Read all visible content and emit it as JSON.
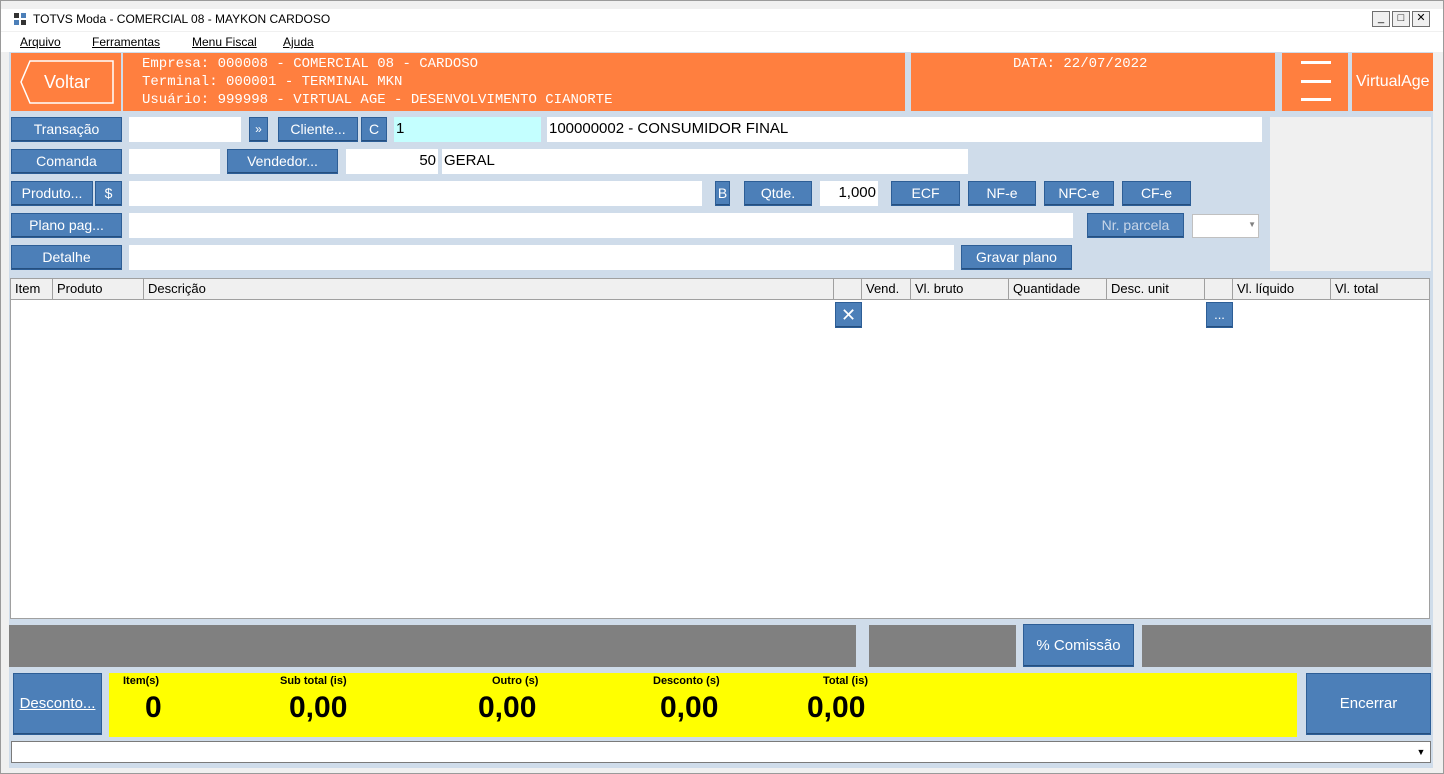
{
  "window": {
    "title": "TOTVS Moda - COMERCIAL 08 - MAYKON CARDOSO",
    "minimize": "_",
    "maximize": "□",
    "close": "✕"
  },
  "menubar": [
    "Arquivo",
    "Ferramentas",
    "Menu Fiscal",
    "Ajuda"
  ],
  "header": {
    "back_label": "Voltar",
    "empresa": "Empresa: 000008 - COMERCIAL 08 - CARDOSO",
    "terminal": "Terminal: 000001 - TERMINAL MKN",
    "usuario": "Usuário: 999998 - VIRTUAL AGE - DESENVOLVIMENTO CIANORTE",
    "data": "DATA: 22/07/2022",
    "brand": "VirtualAge"
  },
  "form": {
    "transacao_label": "Transação",
    "transacao_value": "",
    "more_label": "»",
    "cliente_label": "Cliente...",
    "c_label": "C",
    "cliente_code": "1",
    "cliente_name": "100000002 - CONSUMIDOR FINAL",
    "comanda_label": "Comanda",
    "comanda_value": "",
    "vendedor_label": "Vendedor...",
    "vendedor_code": "50",
    "vendedor_name": "GERAL",
    "produto_label": "Produto...",
    "dollar_label": "$",
    "produto_value": "",
    "b_label": "B",
    "qtde_label": "Qtde.",
    "qtde_value": "1,000",
    "ecf_label": "ECF",
    "nfe_label": "NF-e",
    "nfce_label": "NFC-e",
    "cfe_label": "CF-e",
    "plano_label": "Plano pag...",
    "plano_value": "",
    "nr_parcela_label": "Nr. parcela",
    "parcela_value": "",
    "detalhe_label": "Detalhe",
    "detalhe_value": "",
    "gravar_plano_label": "Gravar plano"
  },
  "grid": {
    "columns": [
      "Item",
      "Produto",
      "Descrição",
      "",
      "Vend.",
      "Vl. bruto",
      "Quantidade",
      "Desc. unit",
      "",
      "Vl. líquido",
      "Vl. total"
    ],
    "delete_icon": "✕",
    "ellipsis": "..."
  },
  "footer": {
    "comissao_label": "% Comissão",
    "desconto_label": "Desconto...",
    "encerrar_label": "Encerrar",
    "itens_label": "Item(s)",
    "itens_value": "0",
    "subtotal_label": "Sub total (is)",
    "subtotal_value": "0,00",
    "outro_label": "Outro (s)",
    "outro_value": "0,00",
    "desconto_total_label": "Desconto (s)",
    "desconto_total_value": "0,00",
    "total_label": "Total (is)",
    "total_value": "0,00"
  },
  "statusbar": {
    "value": "",
    "dropdown": "▼"
  }
}
